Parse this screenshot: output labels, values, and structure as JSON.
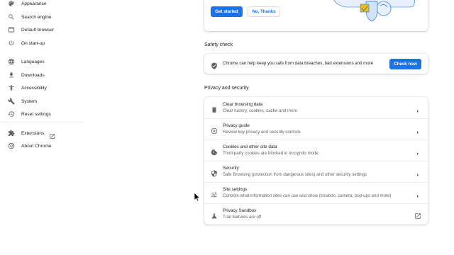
{
  "sidebar": {
    "items": [
      {
        "label": "Appearance",
        "icon": "palette-icon"
      },
      {
        "label": "Search engine",
        "icon": "search-icon"
      },
      {
        "label": "Default browser",
        "icon": "browser-icon"
      },
      {
        "label": "On start-up",
        "icon": "power-icon"
      },
      {
        "label": "Languages",
        "icon": "globe-icon"
      },
      {
        "label": "Downloads",
        "icon": "download-icon"
      },
      {
        "label": "Accessibility",
        "icon": "accessibility-icon"
      },
      {
        "label": "System",
        "icon": "wrench-icon"
      },
      {
        "label": "Reset settings",
        "icon": "history-icon"
      },
      {
        "label": "Extensions",
        "icon": "puzzle-icon"
      },
      {
        "label": "About Chrome",
        "icon": "chrome-icon"
      }
    ]
  },
  "promo": {
    "get_started_label": "Get started",
    "no_thanks_label": "No, Thanks"
  },
  "safety_check": {
    "title": "Safety check",
    "description": "Chrome can help keep you safe from data breaches, bad extensions and more",
    "button_label": "Check now"
  },
  "privacy": {
    "title": "Privacy and security",
    "rows": [
      {
        "title": "Clear browsing data",
        "subtitle": "Clear history, cookies, cache and more",
        "icon": "trash-icon"
      },
      {
        "title": "Privacy guide",
        "subtitle": "Review key privacy and security controls",
        "icon": "compass-icon"
      },
      {
        "title": "Cookies and other site data",
        "subtitle": "Third-party cookies are blocked in Incognito mode",
        "icon": "cookie-icon"
      },
      {
        "title": "Security",
        "subtitle": "Safe Browsing (protection from dangerous sites) and other security settings",
        "icon": "shield-icon"
      },
      {
        "title": "Site settings",
        "subtitle": "Controls what information sites can use and show (location, camera, pop-ups and more)",
        "icon": "sliders-icon"
      },
      {
        "title": "Privacy Sandbox",
        "subtitle": "Trial features are off",
        "icon": "flask-icon"
      }
    ]
  },
  "colors": {
    "accent": "#1a73e8",
    "text_primary": "#202124",
    "text_secondary": "#5f6368"
  }
}
